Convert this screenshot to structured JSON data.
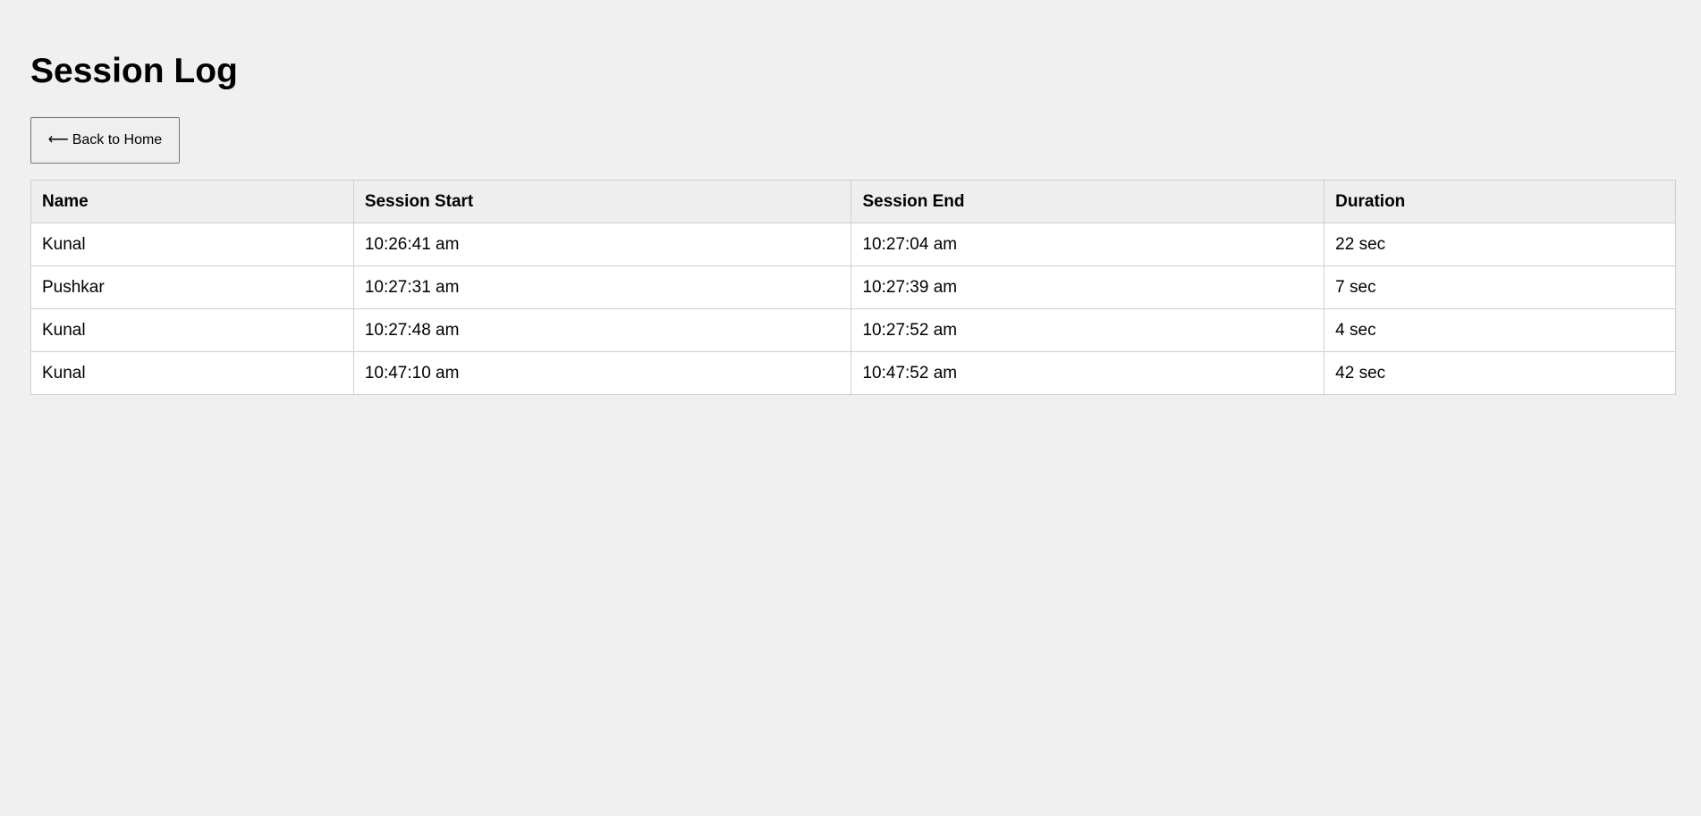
{
  "page": {
    "title": "Session Log"
  },
  "back_button": {
    "arrow_icon": "left-arrow-icon",
    "arrow_glyph": "⟵",
    "label": "Back to Home"
  },
  "table": {
    "headers": [
      "Name",
      "Session Start",
      "Session End",
      "Duration"
    ],
    "rows": [
      [
        "Kunal",
        "10:26:41 am",
        "10:27:04 am",
        "22 sec"
      ],
      [
        "Pushkar",
        "10:27:31 am",
        "10:27:39 am",
        "7 sec"
      ],
      [
        "Kunal",
        "10:27:48 am",
        "10:27:52 am",
        "4 sec"
      ],
      [
        "Kunal",
        "10:47:10 am",
        "10:47:52 am",
        "42 sec"
      ]
    ]
  },
  "colors": {
    "background": "#f0f0f0",
    "table_header_bg": "#eeeeee",
    "table_border": "#cfcfcf"
  }
}
